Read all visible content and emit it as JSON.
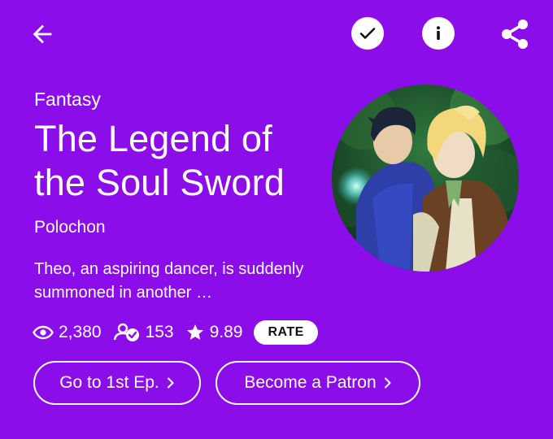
{
  "series": {
    "genre": "Fantasy",
    "title": "The Legend of the Soul Sword",
    "author": "Polochon",
    "description": "Theo, an aspiring dancer, is suddenly summoned in another …"
  },
  "stats": {
    "views": "2,380",
    "subscribers": "153",
    "rating": "9.89",
    "rate_label": "RATE"
  },
  "actions": {
    "first_episode_label": "Go to 1st Ep.",
    "patron_label": "Become a Patron"
  },
  "colors": {
    "background": "#8b0dea",
    "foreground": "#ffffff"
  },
  "icons": {
    "back": "arrow-left-icon",
    "subscribed": "check-circle-icon",
    "info": "info-circle-icon",
    "share": "share-icon",
    "views": "eye-icon",
    "subscribers": "subscribers-icon",
    "rating": "star-icon",
    "chevron": "chevron-right-icon"
  }
}
